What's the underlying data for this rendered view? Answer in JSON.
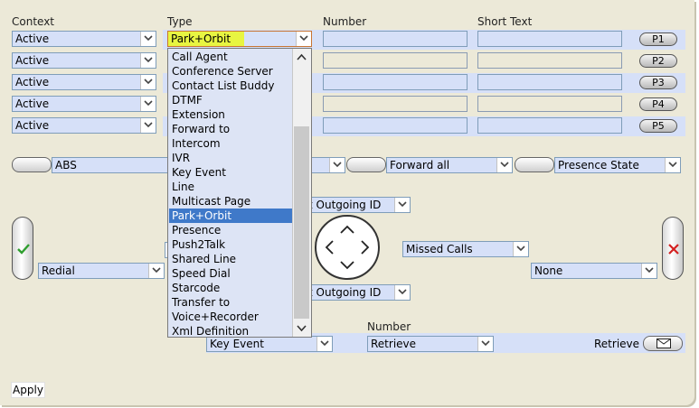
{
  "headers": {
    "context": "Context",
    "type": "Type",
    "number": "Number",
    "short_text": "Short Text"
  },
  "rows": [
    {
      "context": "Active",
      "type": "Park+Orbit",
      "button": "P1"
    },
    {
      "context": "Active",
      "button": "P2"
    },
    {
      "context": "Active",
      "button": "P3"
    },
    {
      "context": "Active",
      "button": "P4"
    },
    {
      "context": "Active",
      "button": "P5"
    }
  ],
  "softkeys": {
    "left": "ABS",
    "mid_right": "Forward all",
    "right": "Presence State"
  },
  "nav": {
    "outgoing_top": "t Outgoing ID",
    "outgoing_bottom": "t Outgoing ID",
    "missed_calls": "Missed Calls",
    "redial": "Redial",
    "none": "None"
  },
  "bottom": {
    "number_header": "Number",
    "key_event": "Key Event",
    "retrieve_select": "Retrieve",
    "retrieve_label": "Retrieve"
  },
  "apply_label": "Apply",
  "dropdown": {
    "selected": "Park+Orbit",
    "options": [
      "Call Agent",
      "Conference Server",
      "Contact List Buddy",
      "DTMF",
      "Extension",
      "Forward to",
      "Intercom",
      "IVR",
      "Key Event",
      "Line",
      "Multicast Page",
      "Park+Orbit",
      "Presence",
      "Push2Talk",
      "Shared Line",
      "Speed Dial",
      "Starcode",
      "Transfer to",
      "Voice+Recorder",
      "Xml Definition"
    ]
  },
  "colors": {
    "panel": "#ece9d8",
    "field": "#d6e0f8",
    "highlight": "#3f79c9",
    "selected_type_bg": "#e8f541",
    "ok_icon": "#2e9e2e",
    "cancel_icon": "#d42020"
  },
  "icons": {
    "ok": "checkmark-icon",
    "cancel": "x-mark-icon",
    "message": "envelope-icon",
    "dpad": "directional-pad-icon"
  }
}
